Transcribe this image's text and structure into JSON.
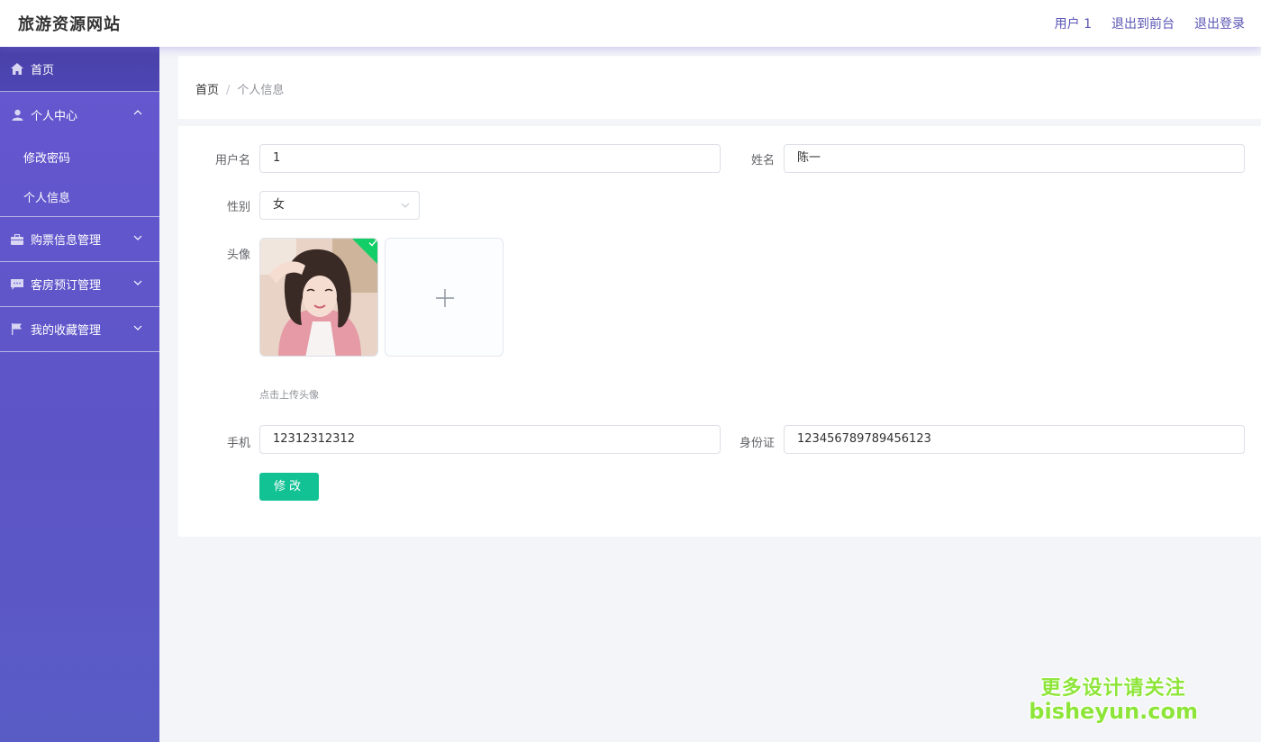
{
  "header": {
    "brand": "旅游资源网站",
    "user_label": "用户 1",
    "back_to_front": "退出到前台",
    "logout": "退出登录"
  },
  "sidebar": {
    "home": "首页",
    "personal_center": "个人中心",
    "change_password": "修改密码",
    "personal_info": "个人信息",
    "ticket_mgmt": "购票信息管理",
    "room_booking_mgmt": "客房预订管理",
    "favorites_mgmt": "我的收藏管理"
  },
  "breadcrumb": {
    "home": "首页",
    "separator": "/",
    "current": "个人信息"
  },
  "form": {
    "username_label": "用户名",
    "username_value": "1",
    "name_label": "姓名",
    "name_value": "陈一",
    "gender_label": "性别",
    "gender_value": "女",
    "avatar_label": "头像",
    "upload_hint": "点击上传头像",
    "phone_label": "手机",
    "phone_value": "12312312312",
    "idcard_label": "身份证",
    "idcard_value": "123456789789456123",
    "submit_label": "修改"
  },
  "watermark": {
    "line1": "更多设计请关注",
    "line2": "bisheyun.com"
  },
  "colors": {
    "sidebar": "#5c55c6",
    "accent_button": "#13c294",
    "header_link": "#5a55b5"
  }
}
